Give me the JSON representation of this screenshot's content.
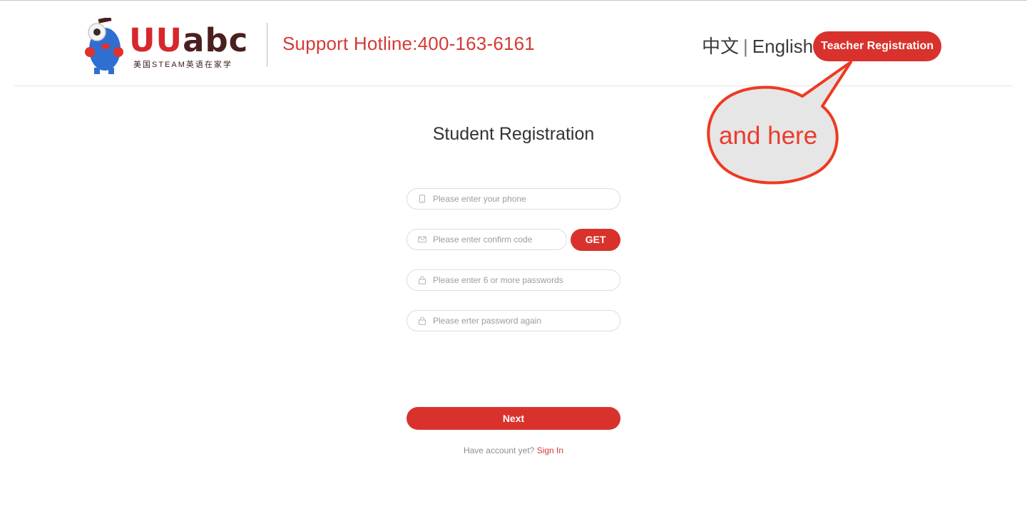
{
  "header": {
    "brand_u1": "U",
    "brand_u2": "U",
    "brand_abc": "abc",
    "tagline": "美国STEAM英语在家学",
    "hotline": "Support Hotline:400-163-6161",
    "lang_chinese": "中文",
    "lang_separator": "|",
    "lang_english": "English",
    "teacher_registration": "Teacher Registration"
  },
  "annotation": {
    "text": "and here"
  },
  "form": {
    "title": "Student Registration",
    "phone_placeholder": "Please enter your phone",
    "code_placeholder": "Please enter confirm code",
    "get_label": "GET",
    "password_placeholder": "Please enter 6 or more passwords",
    "password_again_placeholder": "Please erter password again",
    "next_label": "Next",
    "have_account": "Have account yet?",
    "sign_in": "Sign In"
  },
  "colors": {
    "accent": "#d9322c",
    "hotline": "#d43a35",
    "callout_stroke": "#ee3a22",
    "callout_fill": "#e6e6e6"
  },
  "icons": {
    "phone": "phone-icon",
    "code": "envelope-icon",
    "password": "lock-icon",
    "password_again": "lock-icon"
  }
}
